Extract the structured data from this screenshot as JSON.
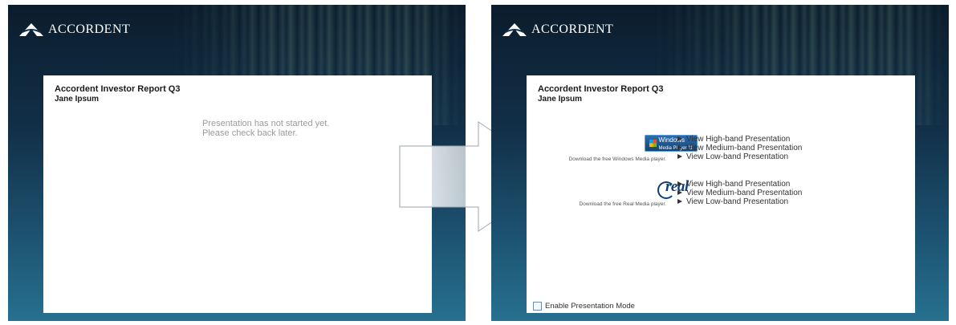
{
  "brand": {
    "name": "ACCORDENT"
  },
  "left_panel": {
    "card": {
      "title": "Accordent Investor Report Q3",
      "subtitle": "Jane Ipsum",
      "status_lines": [
        "Presentation has not started yet.",
        "Please check back later."
      ]
    }
  },
  "right_panel": {
    "card": {
      "title": "Accordent Investor Report Q3",
      "subtitle": "Jane Ipsum",
      "windows_media": {
        "logo_text": "Windows",
        "logo_subtext": "Media Player 11",
        "download_text": "Download the free Windows Media player.",
        "links": [
          "View High-band Presentation",
          "View Medium-band Presentation",
          "View Low-band Presentation"
        ]
      },
      "real_media": {
        "logo_text": "real",
        "download_text": "Download the free Real Media player.",
        "links": [
          "View High-band Presentation",
          "View Medium-band Presentation",
          "View Low-band Presentation"
        ]
      },
      "presentation_mode": {
        "label": "Enable Presentation Mode",
        "checked": false
      }
    }
  },
  "icons": [
    "accordent-logo-icon",
    "windows-media-player-logo",
    "real-player-logo",
    "play-triangle-icon",
    "transition-arrow-icon",
    "checkbox-icon"
  ]
}
